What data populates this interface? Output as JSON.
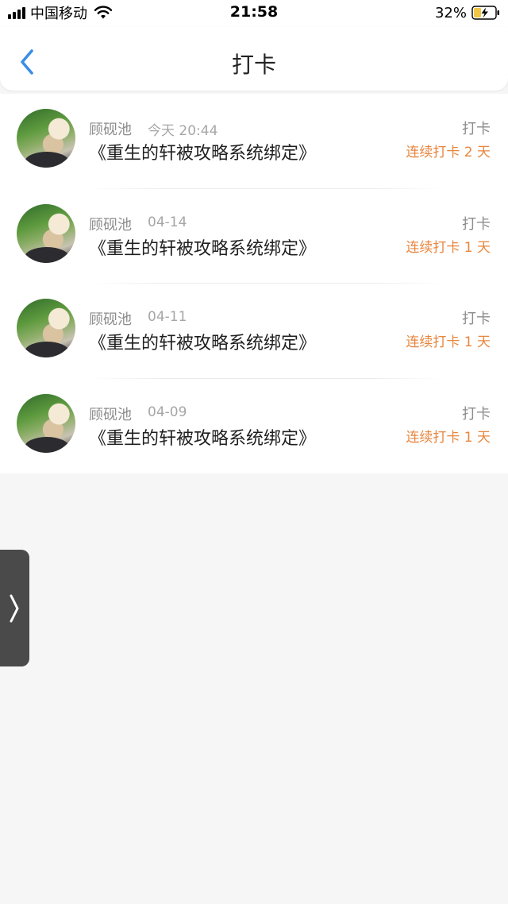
{
  "status_bar": {
    "carrier": "中国移动",
    "time": "21:58",
    "battery": "32%"
  },
  "nav": {
    "title": "打卡",
    "back_icon": "chevron-left-icon",
    "accent": "#3a8ee6"
  },
  "checkins": [
    {
      "author": "顾砚池",
      "time": "今天 20:44",
      "book": "《重生的轩被攻略系统绑定》",
      "tag": "打卡",
      "streak": "连续打卡 2 天"
    },
    {
      "author": "顾砚池",
      "time": "04-14",
      "book": "《重生的轩被攻略系统绑定》",
      "tag": "打卡",
      "streak": "连续打卡 1 天"
    },
    {
      "author": "顾砚池",
      "time": "04-11",
      "book": "《重生的轩被攻略系统绑定》",
      "tag": "打卡",
      "streak": "连续打卡 1 天"
    },
    {
      "author": "顾砚池",
      "time": "04-09",
      "book": "《重生的轩被攻略系统绑定》",
      "tag": "打卡",
      "streak": "连续打卡 1 天"
    }
  ],
  "colors": {
    "streak": "#e8863e",
    "background": "#f6f6f7",
    "handle": "#4a4a4a"
  }
}
